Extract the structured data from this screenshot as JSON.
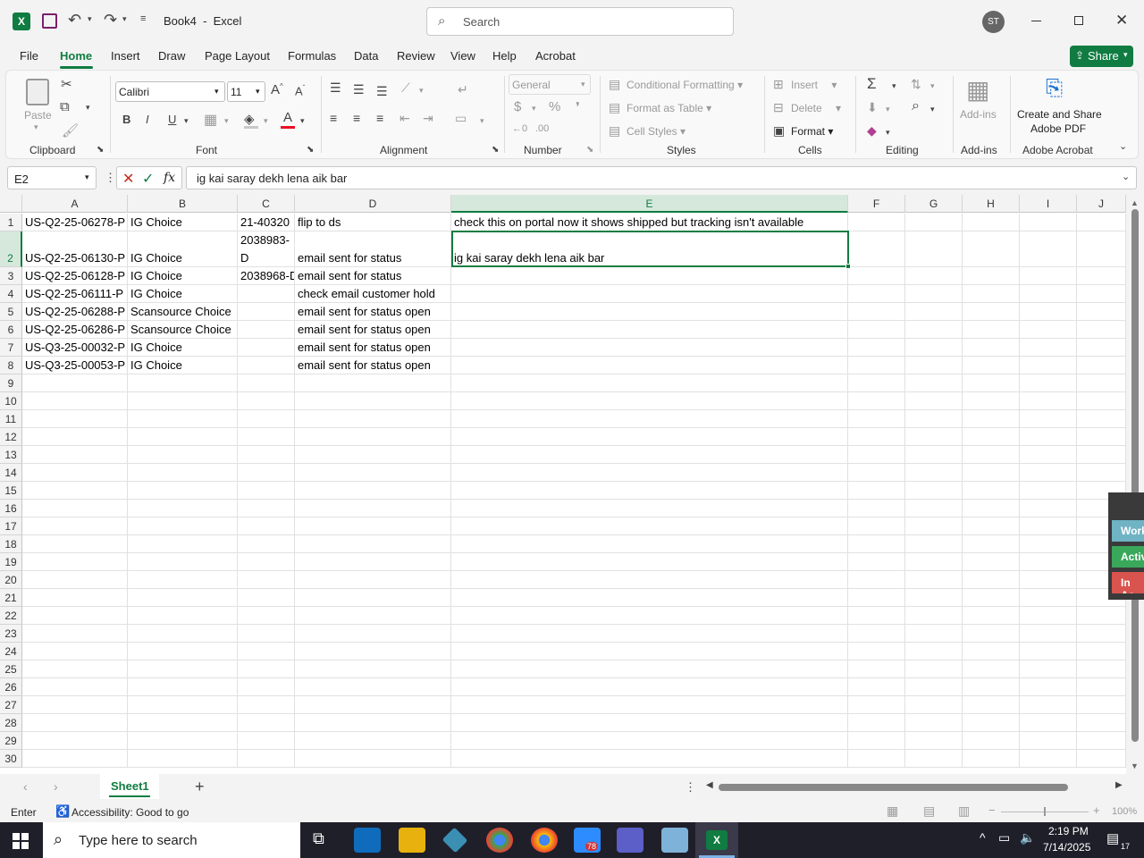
{
  "window": {
    "title": "Book4  -  Excel",
    "search_placeholder": "Search",
    "avatar": "ST"
  },
  "menu": {
    "tabs": [
      "File",
      "Home",
      "Insert",
      "Draw",
      "Page Layout",
      "Formulas",
      "Data",
      "Review",
      "View",
      "Help",
      "Acrobat"
    ],
    "active": "Home",
    "share": "Share"
  },
  "ribbon": {
    "clipboard": {
      "paste": "Paste",
      "label": "Clipboard"
    },
    "font": {
      "name": "Calibri",
      "size": "11",
      "label": "Font",
      "bold": "B",
      "italic": "I",
      "underline": "U",
      "font_color": "#e81123"
    },
    "alignment": {
      "label": "Alignment"
    },
    "number": {
      "format": "General",
      "label": "Number"
    },
    "styles": {
      "conditional": "Conditional Formatting",
      "table": "Format as Table",
      "cell": "Cell Styles",
      "label": "Styles"
    },
    "cells": {
      "insert": "Insert",
      "delete": "Delete",
      "format": "Format",
      "label": "Cells"
    },
    "editing": {
      "label": "Editing"
    },
    "addins": {
      "btn": "Add-ins",
      "label": "Add-ins"
    },
    "acrobat": {
      "line1": "Create and Share",
      "line2": "Adobe PDF",
      "label": "Adobe Acrobat"
    }
  },
  "formula_bar": {
    "name_box": "E2",
    "fx": "fx",
    "content": "ig kai saray dekh lena aik bar"
  },
  "columns": [
    "A",
    "B",
    "C",
    "D",
    "E",
    "F",
    "G",
    "H",
    "I",
    "J"
  ],
  "rows": [
    {
      "n": "1",
      "A": "US-Q2-25-06278-P",
      "B": "IG Choice",
      "C": "21-40320",
      "D": "flip to ds",
      "E": "check this on portal now it shows shipped but tracking isn't available"
    },
    {
      "n": "2",
      "A": "US-Q2-25-06130-P",
      "B": "IG Choice",
      "C1": "2038983-",
      "C": "D",
      "D": "email sent for status",
      "E": "ig kai saray dekh lena aik bar"
    },
    {
      "n": "3",
      "A": "US-Q2-25-06128-P",
      "B": "IG Choice",
      "C": "2038968-D",
      "D": "email sent for status",
      "E": ""
    },
    {
      "n": "4",
      "A": "US-Q2-25-06111-P",
      "B": "IG Choice",
      "C": "",
      "D": "check email customer hold",
      "E": ""
    },
    {
      "n": "5",
      "A": "US-Q2-25-06288-P",
      "B": "Scansource Choice",
      "C": "",
      "D": "email sent for status open",
      "E": ""
    },
    {
      "n": "6",
      "A": "US-Q2-25-06286-P",
      "B": "Scansource Choice",
      "C": "",
      "D": "email sent for status open",
      "E": ""
    },
    {
      "n": "7",
      "A": "US-Q3-25-00032-P",
      "B": "IG Choice",
      "C": "",
      "D": "email sent for status open",
      "E": ""
    },
    {
      "n": "8",
      "A": "US-Q3-25-00053-P",
      "B": "IG Choice",
      "C": "",
      "D": "email sent for status open",
      "E": ""
    }
  ],
  "empty_rows": [
    "9",
    "10",
    "11",
    "12",
    "13",
    "14",
    "15",
    "16",
    "17",
    "18",
    "19",
    "20",
    "21",
    "22",
    "23",
    "24",
    "25",
    "26",
    "27",
    "28",
    "29",
    "30"
  ],
  "side_panel": [
    "Work",
    "Activ",
    "In Ac"
  ],
  "sheets": {
    "active": "Sheet1"
  },
  "status": {
    "mode": "Enter",
    "accessibility": "Accessibility: Good to go",
    "zoom": "100%"
  },
  "taskbar": {
    "search_placeholder": "Type here to search",
    "time": "2:19 PM",
    "date": "7/14/2025",
    "badge": "78",
    "notif": "17"
  },
  "colors": {
    "excel_green": "#107c41",
    "selection": "#107c41"
  }
}
